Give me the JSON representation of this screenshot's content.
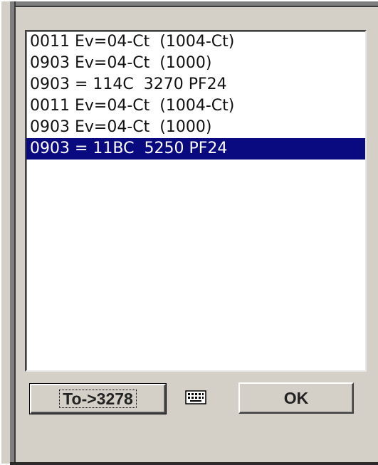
{
  "list": {
    "items": [
      "0011 Ev=04-Ct  (1004-Ct)",
      "0903 Ev=04-Ct  (1000)",
      "0903 = 114C  3270 PF24",
      "0011 Ev=04-Ct  (1004-Ct)",
      "0903 Ev=04-Ct  (1000)",
      "0903 = 11BC  5250 PF24"
    ],
    "selected_index": 5
  },
  "buttons": {
    "to_label": "To->3278",
    "ok_label": "OK"
  },
  "icons": {
    "keyboard": "keyboard-icon"
  },
  "colors": {
    "selection": "#0a0a80",
    "dialog_bg": "#d4d0c8"
  }
}
